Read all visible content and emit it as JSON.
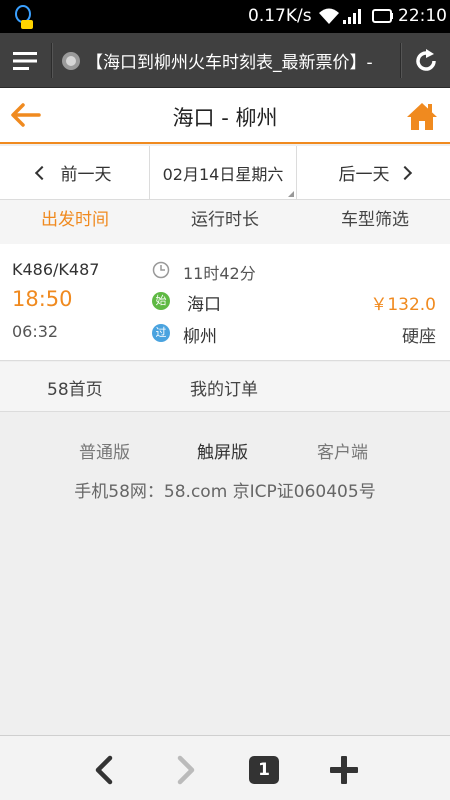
{
  "status_bar": {
    "network_speed": "0.17K/s",
    "time": "22:10",
    "icons": [
      "qq-notification-icon",
      "wifi-icon",
      "signal-icon",
      "battery-icon"
    ]
  },
  "browser": {
    "page_title": "【海口到柳州火车时刻表_最新票价】-",
    "icons": [
      "menu-icon",
      "site-icon",
      "refresh-icon"
    ]
  },
  "header": {
    "title": "海口 - 柳州",
    "icons": [
      "back-arrow-icon",
      "home-icon"
    ]
  },
  "date_bar": {
    "prev_label": "前一天",
    "date": "02月14日星期六",
    "next_label": "后一天"
  },
  "sort_tabs": [
    {
      "label": "出发时间",
      "active": true
    },
    {
      "label": "运行时长",
      "active": false
    },
    {
      "label": "车型筛选",
      "active": false
    }
  ],
  "trains": [
    {
      "train_no": "K486/K487",
      "depart_time": "18:50",
      "arrive_time": "06:32",
      "duration": "11时42分",
      "from_badge": "始",
      "from_station": "海口",
      "to_badge": "过",
      "to_station": "柳州",
      "price": "￥132.0",
      "seat_type": "硬座"
    }
  ],
  "footer": {
    "home_link": "58首页",
    "orders_link": "我的订单",
    "versions": [
      "普通版",
      "触屏版",
      "客户端"
    ],
    "copyright": "手机58网：58.com 京ICP证060405号"
  },
  "toolbar": {
    "tab_count": "1",
    "icons": [
      "back-icon",
      "forward-icon",
      "tabs-icon",
      "new-tab-icon"
    ]
  },
  "colors": {
    "accent": "#f08a1f",
    "start_badge": "#5fb944",
    "pass_badge": "#4aa3df"
  }
}
